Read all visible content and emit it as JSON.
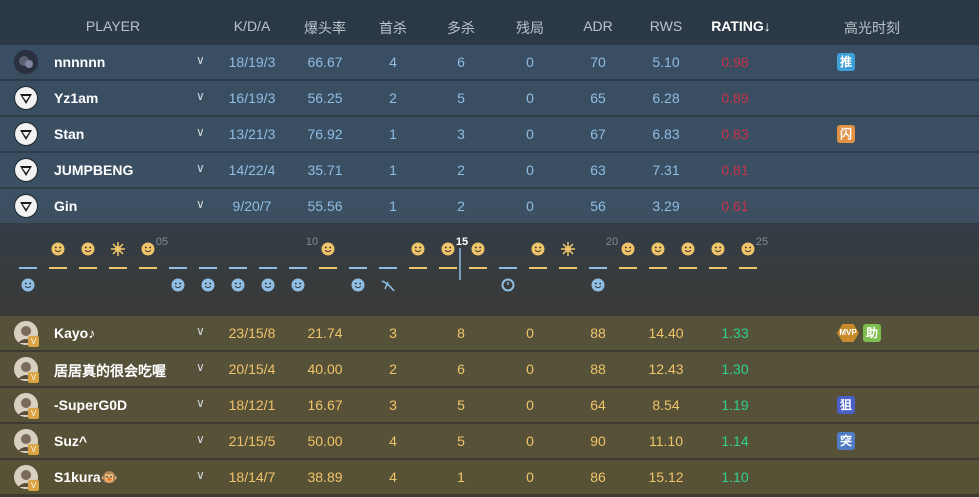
{
  "header": {
    "player": "PLAYER",
    "kda": "K/D/A",
    "hs": "爆头率",
    "first_kill": "首杀",
    "multi_kill": "多杀",
    "clutch": "残局",
    "adr": "ADR",
    "rws": "RWS",
    "rating": "RATING↓",
    "highlight": "高光时刻"
  },
  "team_ct": [
    {
      "name": "nnnnnn",
      "kda": "18/19/3",
      "hs": "66.67",
      "fk": "4",
      "mk": "6",
      "cl": "0",
      "adr": "70",
      "rws": "5.10",
      "rating": "0.98",
      "badges": [
        "推"
      ]
    },
    {
      "name": "Yz1am",
      "kda": "16/19/3",
      "hs": "56.25",
      "fk": "2",
      "mk": "5",
      "cl": "0",
      "adr": "65",
      "rws": "6.28",
      "rating": "0.89",
      "badges": []
    },
    {
      "name": "Stan",
      "kda": "13/21/3",
      "hs": "76.92",
      "fk": "1",
      "mk": "3",
      "cl": "0",
      "adr": "67",
      "rws": "6.83",
      "rating": "0.83",
      "badges": [
        "闪"
      ]
    },
    {
      "name": "JUMPBENG",
      "kda": "14/22/4",
      "hs": "35.71",
      "fk": "1",
      "mk": "2",
      "cl": "0",
      "adr": "63",
      "rws": "7.31",
      "rating": "0.81",
      "badges": []
    },
    {
      "name": "Gin",
      "kda": "9/20/7",
      "hs": "55.56",
      "fk": "1",
      "mk": "2",
      "cl": "0",
      "adr": "56",
      "rws": "3.29",
      "rating": "0.61",
      "badges": []
    }
  ],
  "team_t": [
    {
      "name": "Kayo♪",
      "kda": "23/15/8",
      "hs": "21.74",
      "fk": "3",
      "mk": "8",
      "cl": "0",
      "adr": "88",
      "rws": "14.40",
      "rating": "1.33",
      "badges": [
        "MVP",
        "助"
      ]
    },
    {
      "name": "居居真的很会吃喔",
      "kda": "20/15/4",
      "hs": "40.00",
      "fk": "2",
      "mk": "6",
      "cl": "0",
      "adr": "88",
      "rws": "12.43",
      "rating": "1.30",
      "badges": []
    },
    {
      "name": "-SuperG0D",
      "kda": "18/12/1",
      "hs": "16.67",
      "fk": "3",
      "mk": "5",
      "cl": "0",
      "adr": "64",
      "rws": "8.54",
      "rating": "1.19",
      "badges": [
        "狙"
      ]
    },
    {
      "name": "Suz^",
      "kda": "21/15/5",
      "hs": "50.00",
      "fk": "4",
      "mk": "5",
      "cl": "0",
      "adr": "90",
      "rws": "11.10",
      "rating": "1.14",
      "badges": [
        "突"
      ]
    },
    {
      "name": "S1kura🐵",
      "kda": "18/14/7",
      "hs": "38.89",
      "fk": "4",
      "mk": "1",
      "cl": "0",
      "adr": "86",
      "rws": "15.12",
      "rating": "1.10",
      "badges": []
    }
  ],
  "timeline": {
    "markers": [
      "05",
      "10",
      "15",
      "20",
      "25"
    ],
    "current": "15",
    "rounds": [
      {
        "win": "ct",
        "icon": "smile"
      },
      {
        "win": "t",
        "icon": "smile"
      },
      {
        "win": "t",
        "icon": "smile"
      },
      {
        "win": "t",
        "icon": "burst"
      },
      {
        "win": "t",
        "icon": "smile"
      },
      {
        "win": "ct",
        "icon": "smile"
      },
      {
        "win": "ct",
        "icon": "smile"
      },
      {
        "win": "ct",
        "icon": "smile"
      },
      {
        "win": "ct",
        "icon": "smile"
      },
      {
        "win": "ct",
        "icon": "smile"
      },
      {
        "win": "t",
        "icon": "smile"
      },
      {
        "win": "ct",
        "icon": "smile"
      },
      {
        "win": "ct",
        "icon": "defuse"
      },
      {
        "win": "t",
        "icon": "smile"
      },
      {
        "win": "t",
        "icon": "smile"
      },
      {
        "win": "t",
        "icon": "smile"
      },
      {
        "win": "ct",
        "icon": "timer"
      },
      {
        "win": "t",
        "icon": "smile"
      },
      {
        "win": "t",
        "icon": "burst"
      },
      {
        "win": "ct",
        "icon": "smile"
      },
      {
        "win": "t",
        "icon": "smile"
      },
      {
        "win": "t",
        "icon": "smile"
      },
      {
        "win": "t",
        "icon": "smile"
      },
      {
        "win": "t",
        "icon": "smile"
      },
      {
        "win": "t",
        "icon": "smile"
      }
    ]
  },
  "colors": {
    "ct": "#8fbde3",
    "t": "#f0c46a",
    "bad": "#c8324a",
    "good": "#2fd08e"
  }
}
